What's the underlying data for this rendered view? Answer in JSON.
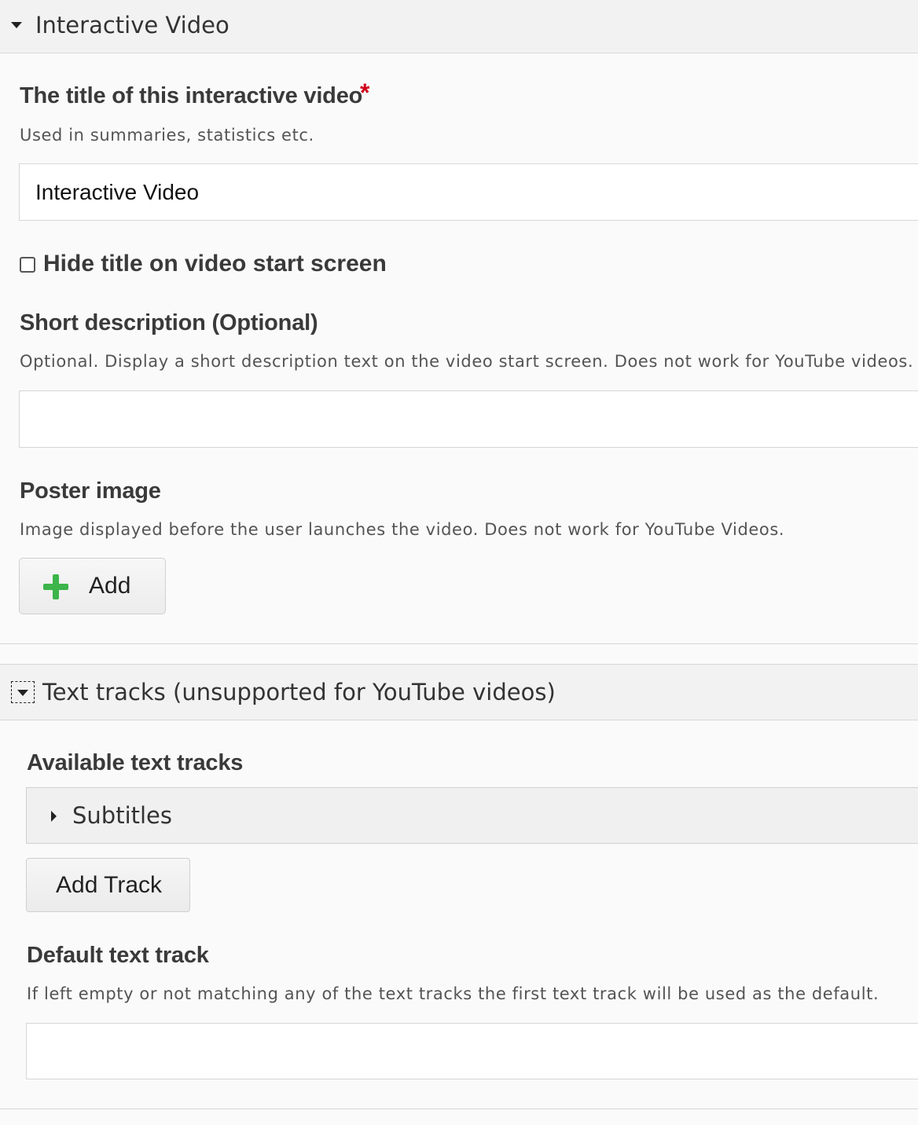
{
  "section_interactive_video": {
    "header_title": "Interactive Video",
    "title_field": {
      "label": "The title of this interactive video",
      "required_mark": "*",
      "description": "Used in summaries, statistics etc.",
      "value": "Interactive Video"
    },
    "hide_title_checkbox": {
      "label": "Hide title on video start screen",
      "checked": false
    },
    "short_description_field": {
      "label": "Short description (Optional)",
      "description": "Optional. Display a short description text on the video start screen. Does not work for YouTube videos.",
      "value": ""
    },
    "poster_image_field": {
      "label": "Poster image",
      "description": "Image displayed before the user launches the video. Does not work for YouTube Videos.",
      "add_button_label": "Add"
    }
  },
  "section_text_tracks": {
    "header_title": "Text tracks (unsupported for YouTube videos)",
    "available_tracks": {
      "label": "Available text tracks",
      "items": [
        {
          "label": "Subtitles"
        }
      ],
      "add_track_label": "Add Track"
    },
    "default_track_field": {
      "label": "Default text track",
      "description": "If left empty or not matching any of the text tracks the first text track will be used as the default.",
      "value": ""
    }
  },
  "colors": {
    "required": "#d0021b",
    "plus_icon": "#3cb54a",
    "header_bg": "#f2f2f2",
    "page_bg": "#fafafa"
  }
}
